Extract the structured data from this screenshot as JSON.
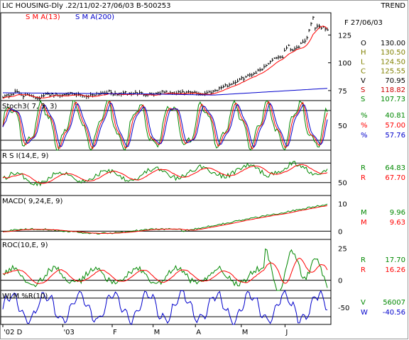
{
  "header": {
    "title": "LIC HOUSING-Dly .22/11/02-27/06/03  B-500253",
    "trend": "TREND",
    "date": "F 27/06/03"
  },
  "chart_data": [
    {
      "type": "candlestick",
      "name": "price",
      "legend": [
        {
          "label": "S M A(13)",
          "color": "#ff0000"
        },
        {
          "label": "S M A(200)",
          "color": "#0000cc"
        }
      ],
      "y_ticks": [
        75,
        100,
        125
      ],
      "ylim": [
        66,
        145
      ],
      "anchors": [
        [
          0,
          70
        ],
        [
          10,
          71
        ],
        [
          20,
          74
        ],
        [
          30,
          70
        ],
        [
          40,
          71
        ],
        [
          50,
          68
        ],
        [
          60,
          71
        ],
        [
          70,
          72
        ],
        [
          80,
          70
        ],
        [
          90,
          73
        ],
        [
          100,
          71
        ],
        [
          110,
          71
        ],
        [
          120,
          70
        ],
        [
          130,
          72
        ],
        [
          140,
          73
        ],
        [
          150,
          74
        ],
        [
          160,
          71
        ],
        [
          170,
          73
        ],
        [
          180,
          72
        ],
        [
          190,
          73
        ],
        [
          200,
          72
        ],
        [
          210,
          72
        ],
        [
          220,
          73
        ],
        [
          230,
          74
        ],
        [
          240,
          72
        ],
        [
          250,
          73
        ],
        [
          260,
          73
        ],
        [
          270,
          73
        ],
        [
          280,
          72
        ],
        [
          290,
          73
        ],
        [
          300,
          75
        ],
        [
          310,
          78
        ],
        [
          320,
          80
        ],
        [
          330,
          83
        ],
        [
          340,
          86
        ],
        [
          350,
          89
        ],
        [
          360,
          92
        ],
        [
          370,
          96
        ],
        [
          380,
          102
        ],
        [
          390,
          106
        ],
        [
          395,
          103
        ],
        [
          400,
          112
        ],
        [
          405,
          115
        ],
        [
          410,
          111
        ],
        [
          415,
          114
        ],
        [
          420,
          115
        ],
        [
          425,
          118
        ],
        [
          430,
          120
        ],
        [
          435,
          132
        ],
        [
          440,
          142
        ],
        [
          443,
          130
        ],
        [
          447,
          135
        ],
        [
          450,
          131
        ],
        [
          455,
          133
        ],
        [
          460,
          129
        ]
      ],
      "sma_levels": [
        [
          0,
          73
        ],
        [
          200,
          72
        ],
        [
          300,
          71
        ],
        [
          460,
          77
        ]
      ],
      "values": {
        "O": "130.00",
        "H": "130.50",
        "L": "124.50",
        "C": "125.55",
        "V": "70.95",
        "S1": "118.82",
        "S2": "107.73"
      }
    },
    {
      "type": "line",
      "name": "stochastic",
      "label": "Stoch3( 7, 3, 3)",
      "y_ticks": [
        50
      ],
      "ylim": [
        0,
        100
      ],
      "levels": [
        20,
        80
      ],
      "values": [
        {
          "label": "%",
          "value": "40.81",
          "color": "#008800"
        },
        {
          "label": "%",
          "value": "57.00",
          "color": "#ff0000"
        },
        {
          "label": "%",
          "value": "57.76",
          "color": "#0000cc"
        }
      ]
    },
    {
      "type": "line",
      "name": "rsi",
      "label": "R S I(14,E, 9)",
      "y_ticks": [
        50
      ],
      "ylim": [
        30,
        100
      ],
      "levels": [
        50,
        80
      ],
      "values": [
        {
          "label": "R",
          "value": "64.83",
          "color": "#008800"
        },
        {
          "label": "R",
          "value": "67.70",
          "color": "#ff0000"
        }
      ]
    },
    {
      "type": "line",
      "name": "macd",
      "label": "MACD( 9,24,E, 9)",
      "y_ticks": [
        10,
        0
      ],
      "ylim": [
        -3,
        13
      ],
      "levels": [
        0
      ],
      "values": [
        {
          "label": "M",
          "value": "9.96",
          "color": "#008800"
        },
        {
          "label": "M",
          "value": "9.63",
          "color": "#ff0000"
        }
      ]
    },
    {
      "type": "line",
      "name": "roc",
      "label": "ROC(10,E, 9)",
      "y_ticks": [
        25,
        0
      ],
      "ylim": [
        -8,
        32
      ],
      "levels": [
        0
      ],
      "values": [
        {
          "label": "R",
          "value": "17.70",
          "color": "#008800"
        },
        {
          "label": "R",
          "value": "16.26",
          "color": "#ff0000"
        }
      ]
    },
    {
      "type": "line",
      "name": "williams",
      "label": "WLM %R(10)",
      "y_ticks": [
        -50
      ],
      "ylim": [
        -105,
        5
      ],
      "levels": [
        -20,
        -80
      ],
      "values": [
        {
          "label": "V",
          "value": "56007",
          "color": "#008800"
        },
        {
          "label": "W",
          "value": "-40.56",
          "color": "#0000cc"
        }
      ]
    }
  ],
  "x_axis": {
    "labels": [
      {
        "text": "'02 D",
        "pos": 0
      },
      {
        "text": "'03",
        "pos": 85
      },
      {
        "text": "F",
        "pos": 155
      },
      {
        "text": "M",
        "pos": 213
      },
      {
        "text": "A",
        "pos": 273
      },
      {
        "text": "M",
        "pos": 338
      },
      {
        "text": "J",
        "pos": 400
      }
    ],
    "span": 460
  }
}
